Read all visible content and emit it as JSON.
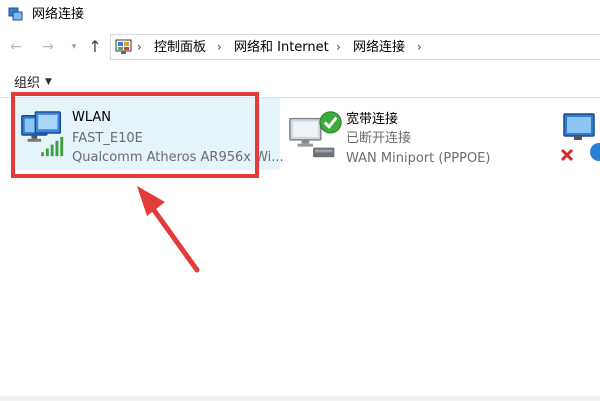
{
  "window": {
    "title": "网络连接"
  },
  "address": {
    "crumbs": [
      "控制面板",
      "网络和 Internet",
      "网络连接"
    ]
  },
  "toolbar": {
    "organize_label": "组织"
  },
  "connections": [
    {
      "name": "WLAN",
      "network": "FAST_E10E",
      "adapter": "Qualcomm Atheros AR956x Wi..."
    },
    {
      "name": "宽带连接",
      "network": "已断开连接",
      "adapter": "WAN Miniport (PPPOE)"
    }
  ],
  "colors": {
    "highlight": "#e33b3b",
    "selection": "#e5f3fb",
    "secondary_text": "#6d6d6d"
  }
}
